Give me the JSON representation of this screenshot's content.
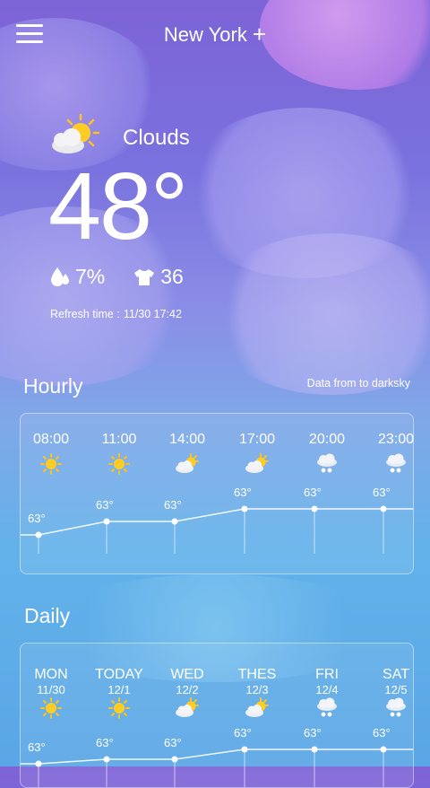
{
  "header": {
    "city": "New York",
    "add_glyph": "+",
    "menu_icon": "hamburger-menu-icon"
  },
  "current": {
    "condition": "Clouds",
    "condition_icon": "sun-behind-cloud-icon",
    "temperature": "48°",
    "humidity": "7%",
    "humidity_icon": "water-drop-icon",
    "clothing_index": "36",
    "clothing_icon": "shirt-icon",
    "refresh_label": "Refresh time :",
    "refresh_time": "11/30 17:42"
  },
  "hourly": {
    "title": "Hourly",
    "source": "Data from to  darksky",
    "items": [
      {
        "time": "08:00",
        "icon": "sunny",
        "temp": "63°"
      },
      {
        "time": "11:00",
        "icon": "sunny",
        "temp": "63°"
      },
      {
        "time": "14:00",
        "icon": "partly-cloudy",
        "temp": "63°"
      },
      {
        "time": "17:00",
        "icon": "partly-cloudy",
        "temp": "63°"
      },
      {
        "time": "20:00",
        "icon": "snow",
        "temp": "63°"
      },
      {
        "time": "23:00",
        "icon": "snow",
        "temp": "63°"
      }
    ]
  },
  "daily": {
    "title": "Daily",
    "items": [
      {
        "day": "MON",
        "date": "11/30",
        "icon": "sunny",
        "temp": "63°"
      },
      {
        "day": "TODAY",
        "date": "12/1",
        "icon": "sunny",
        "temp": "63°"
      },
      {
        "day": "WED",
        "date": "12/2",
        "icon": "partly-cloudy",
        "temp": "63°"
      },
      {
        "day": "THES",
        "date": "12/3",
        "icon": "partly-cloudy",
        "temp": "63°"
      },
      {
        "day": "FRI",
        "date": "12/4",
        "icon": "snow",
        "temp": "63°"
      },
      {
        "day": "SAT",
        "date": "12/5",
        "icon": "snow",
        "temp": "63°"
      }
    ]
  }
}
